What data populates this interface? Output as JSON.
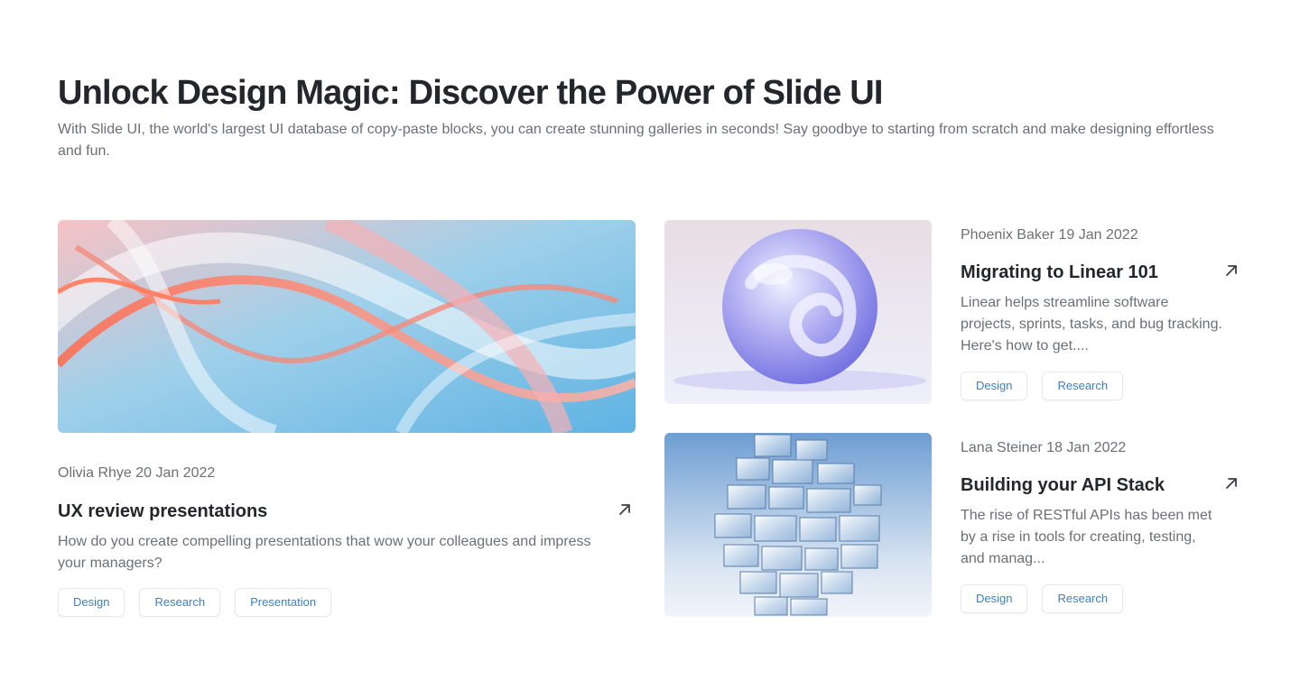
{
  "header": {
    "title": "Unlock Design Magic: Discover the Power of Slide UI",
    "subtitle": "With Slide UI, the world's largest UI database of copy-paste blocks, you can create stunning galleries in seconds! Say goodbye to starting from scratch and make designing effortless and fun."
  },
  "posts": [
    {
      "meta": "Olivia Rhye 20 Jan 2022",
      "title": "UX review presentations",
      "description": "How do you create compelling presentations that wow your colleagues and impress your managers?",
      "tags": [
        "Design",
        "Research",
        "Presentation"
      ]
    },
    {
      "meta": "Phoenix Baker 19 Jan 2022",
      "title": "Migrating to Linear 101",
      "description": "Linear helps streamline software projects, sprints, tasks, and bug tracking. Here's how to get....",
      "tags": [
        "Design",
        "Research"
      ]
    },
    {
      "meta": "Lana Steiner 18 Jan 2022",
      "title": "Building your API Stack",
      "description": "The rise of RESTful APIs has been met by a rise in tools for creating, testing, and manag...",
      "tags": [
        "Design",
        "Research"
      ]
    }
  ],
  "icons": {
    "arrow": "arrow-up-right-icon"
  },
  "colors": {
    "tag_text": "#3b82c4",
    "heading": "#23272b",
    "body_text": "#6b7075"
  }
}
